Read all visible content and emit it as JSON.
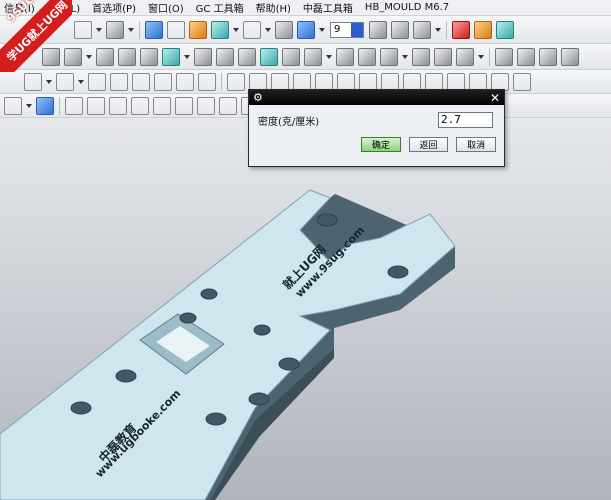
{
  "menubar": {
    "items": [
      "信息(I)",
      "分析(L)",
      "首选项(P)",
      "窗口(O)",
      "GC 工具箱",
      "帮助(H)",
      "中磊工具箱",
      "HB_MOULD M6.7"
    ]
  },
  "logo": {
    "top_text": "9SUG",
    "band_text": "学UG就上UG网"
  },
  "toolbar": {
    "layer_value": "9"
  },
  "dialog": {
    "label": "密度(克/厘米)",
    "value": "2.7",
    "ok_label": "确定",
    "back_label": "返回",
    "cancel_label": "取消",
    "close_glyph": "✕",
    "settings_glyph": "⚙"
  },
  "part": {
    "watermark_1": "就上UG网",
    "watermark_2": "www.9sug.com",
    "watermark_3": "中磊教育",
    "watermark_4": "www.ugbooke.com"
  }
}
